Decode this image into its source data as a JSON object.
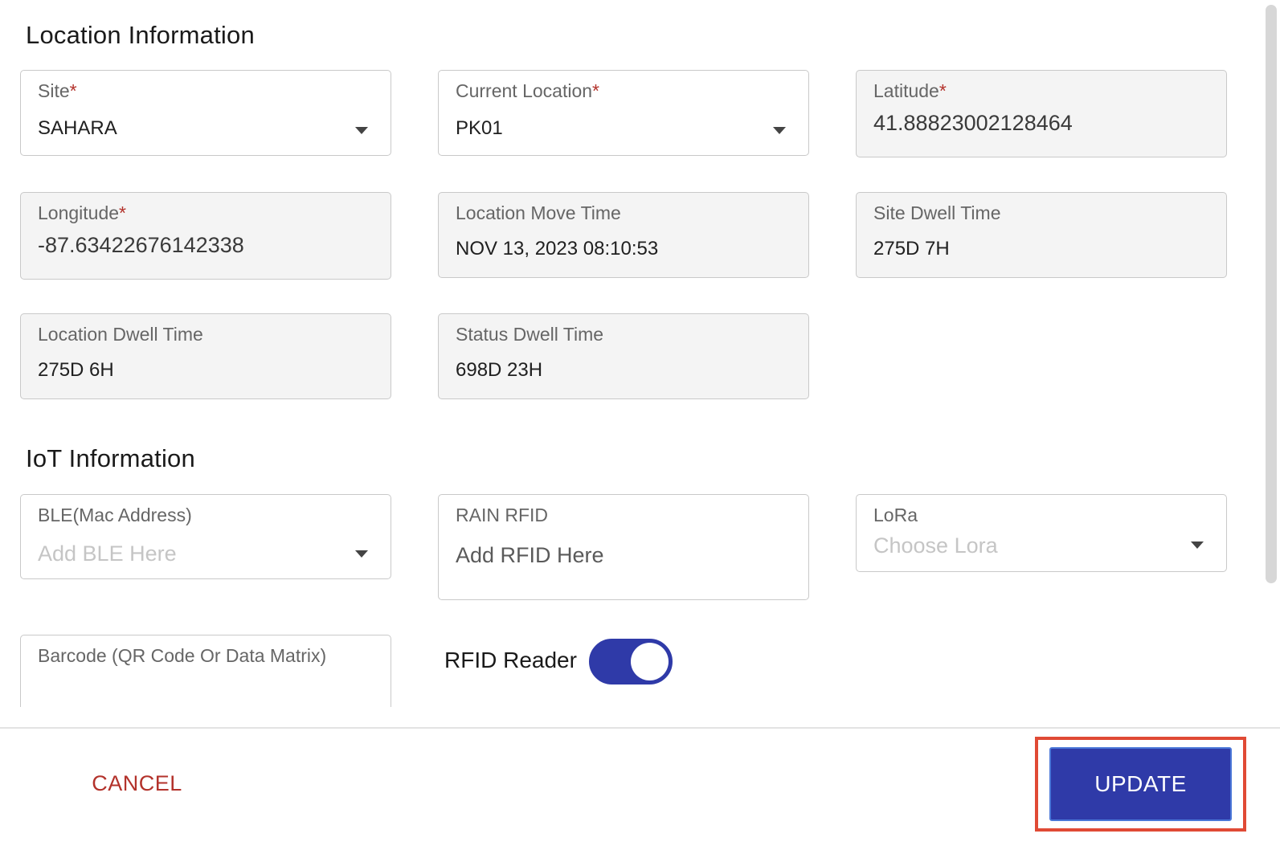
{
  "sections": {
    "location_title": "Location Information",
    "iot_title": "IoT Information"
  },
  "location": {
    "site": {
      "label": "Site",
      "required": "*",
      "value": "SAHARA"
    },
    "current_location": {
      "label": "Current Location",
      "required": "*",
      "value": "PK01"
    },
    "latitude": {
      "label": "Latitude",
      "required": "*",
      "value": "41.88823002128464"
    },
    "longitude": {
      "label": "Longitude",
      "required": "*",
      "value": "-87.63422676142338"
    },
    "location_move_time": {
      "label": "Location Move Time",
      "value": "NOV 13, 2023 08:10:53"
    },
    "site_dwell_time": {
      "label": "Site Dwell Time",
      "value": "275D 7H"
    },
    "location_dwell_time": {
      "label": "Location Dwell Time",
      "value": "275D 6H"
    },
    "status_dwell_time": {
      "label": "Status Dwell Time",
      "value": "698D 23H"
    }
  },
  "iot": {
    "ble": {
      "label": "BLE(Mac Address)",
      "placeholder": "Add BLE Here"
    },
    "rain_rfid": {
      "label": "RAIN RFID",
      "placeholder": "Add RFID Here"
    },
    "lora": {
      "label": "LoRa",
      "placeholder": "Choose Lora"
    },
    "barcode": {
      "label": "Barcode (QR Code Or Data Matrix)"
    },
    "rfid_reader": {
      "label": "RFID Reader",
      "enabled": true
    }
  },
  "footer": {
    "cancel_label": "CANCEL",
    "update_label": "UPDATE"
  },
  "colors": {
    "primary": "#2f3aa8",
    "danger": "#b3322b",
    "highlight": "#e04a35"
  }
}
